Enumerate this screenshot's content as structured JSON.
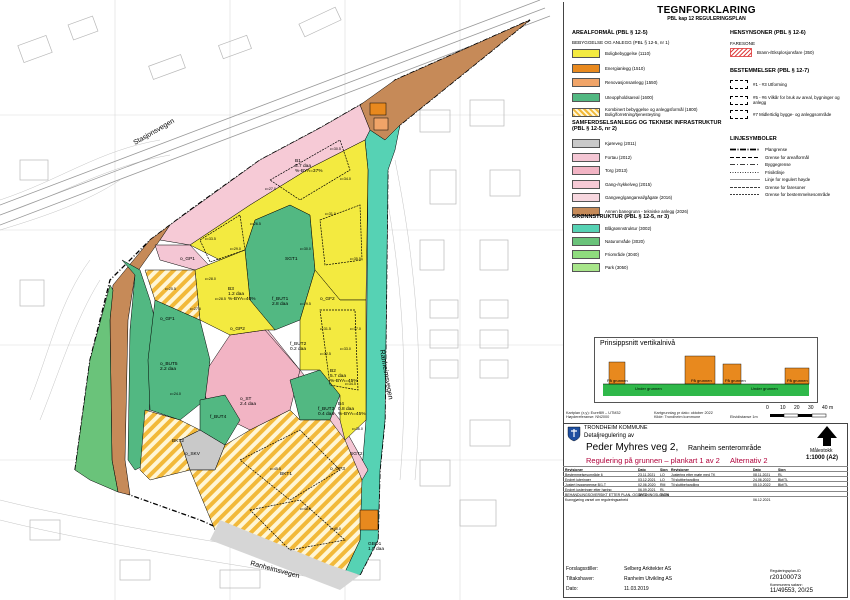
{
  "map": {
    "road_labels": [
      "Stasjonsvegen",
      "Ranheimsvegen",
      "Ranheimsvegen"
    ],
    "zone_labels": [
      {
        "code": "B1",
        "detail": "5.7 daa",
        "extra": "%-BYA=37%"
      },
      {
        "code": "B3",
        "detail": "1.2 daa",
        "extra": "%-BYA=40%"
      },
      {
        "code": "f_BUT1",
        "detail": "2.8 daa",
        "extra": ""
      },
      {
        "code": "f_BUT2",
        "detail": "0.2 daa",
        "extra": ""
      },
      {
        "code": "f_BUT3",
        "detail": "0.4 daa",
        "extra": ""
      },
      {
        "code": "f_BUT4",
        "detail": "",
        "extra": ""
      },
      {
        "code": "o_BUT5",
        "detail": "2.2 daa",
        "extra": ""
      },
      {
        "code": "B2",
        "detail": "5.7 daa",
        "extra": "%-BYA=45%"
      },
      {
        "code": "B4",
        "detail": "0.8 daa",
        "extra": "%-BYA=45%"
      },
      {
        "code": "BKT1",
        "detail": "",
        "extra": ""
      },
      {
        "code": "BKT2",
        "detail": "",
        "extra": ""
      },
      {
        "code": "o_ST",
        "detail": "2.4 daa",
        "extra": ""
      },
      {
        "code": "SGT1",
        "detail": "",
        "extra": ""
      },
      {
        "code": "SGT2",
        "detail": "",
        "extra": ""
      },
      {
        "code": "o_SKV",
        "detail": "",
        "extra": ""
      },
      {
        "code": "GBO1",
        "detail": "1.0 daa",
        "extra": ""
      },
      {
        "code": "o_GF1",
        "detail": "",
        "extra": ""
      },
      {
        "code": "o_GF2",
        "detail": "",
        "extra": ""
      },
      {
        "code": "o_GP1",
        "detail": "",
        "extra": ""
      },
      {
        "code": "o_GP2",
        "detail": "",
        "extra": ""
      },
      {
        "code": "o_GP3",
        "detail": "",
        "extra": ""
      }
    ],
    "heights": [
      "c=27.0",
      "c=30.5",
      "c=31.0",
      "c=29.0",
      "c=33.5",
      "c=30.0",
      "c=26.5",
      "c=34.0",
      "c=35.5",
      "c=31.5",
      "c=28.0",
      "c=25.5",
      "c=24.0",
      "c=28.5",
      "c=37.0",
      "c=33.0",
      "c=32.5",
      "c=34.5",
      "c=36.0",
      "c=27.5",
      "c=29.5",
      "c=48.5",
      "c=45.5",
      "c=40.0"
    ]
  },
  "legend": {
    "title": "TEGNFORKLARING",
    "subtitle": "PBL kap 12 REGULERINGSPLAN",
    "left_sections": [
      {
        "heading": "AREALFORMÅL (PBL § 12-5)",
        "subheading": "BEBYGGELSE OG ANLEGG (PBL § 12-5, nr 1)",
        "items": [
          {
            "label": "Boligbebyggelse (1110)",
            "color": "#f3ea40",
            "pattern": "solid"
          },
          {
            "label": "Energianlegg (1510)",
            "color": "#e8891e",
            "pattern": "solid"
          },
          {
            "label": "Renovasjonsanlegg (1550)",
            "color": "#f0a468",
            "pattern": "solid"
          },
          {
            "label": "Uteoppholdsareal (1600)",
            "color": "#52b882",
            "pattern": "solid"
          },
          {
            "label": "Kombinert bebyggelse og anleggsformål (1800) Bolig/forretning/tjenesteyting",
            "color": "#f2b93a",
            "pattern": "stripes"
          }
        ]
      },
      {
        "heading": "SAMFERDSELSANLEGG OG TEKNISK INFRASTRUKTUR (PBL § 12-5, nr 2)",
        "subheading": "",
        "items": [
          {
            "label": "Kjøreveg (2011)",
            "color": "#c9c9c9",
            "pattern": "solid"
          },
          {
            "label": "Fortau (2012)",
            "color": "#f4c6d4",
            "pattern": "solid"
          },
          {
            "label": "Torg (2013)",
            "color": "#f2b4c4",
            "pattern": "solid"
          },
          {
            "label": "Gang-/sykkelveg (2015)",
            "color": "#f6cad6",
            "pattern": "solid"
          },
          {
            "label": "Gangveg/gangareal/gågate (2016)",
            "color": "#f7d7df",
            "pattern": "solid"
          },
          {
            "label": "Annen banegrunn - tekniske anlegg (2026)",
            "color": "#c68a58",
            "pattern": "solid"
          }
        ]
      },
      {
        "heading": "GRØNNSTRUKTUR (PBL § 12-5, nr 3)",
        "subheading": "",
        "items": [
          {
            "label": "Blågrønnstruktur (3002)",
            "color": "#56d2b4",
            "pattern": "solid"
          },
          {
            "label": "Naturområde (3020)",
            "color": "#6ac37a",
            "pattern": "solid"
          },
          {
            "label": "Friområde (3040)",
            "color": "#8fdc7e",
            "pattern": "solid"
          },
          {
            "label": "Park (3050)",
            "color": "#a8e68a",
            "pattern": "solid"
          }
        ]
      }
    ],
    "hensynsoner": {
      "heading": "HENSYNSONER (PBL § 12-6)",
      "subheading": "FARESONE",
      "items": [
        {
          "label": "Brann-/Eksplosjonsfare (350)"
        }
      ]
    },
    "bestemmelser": {
      "heading": "BESTEMMELSER (PBL § 12-7)",
      "items": [
        {
          "label": "#1 - #3 Utforming"
        },
        {
          "label": "#5 - #6 Vilkår for bruk av areal, bygninger og anlegg"
        },
        {
          "label": "#7 Midlertidig bygge- og anleggsområde"
        }
      ]
    },
    "linjesymboler": {
      "heading": "LINJESYMBOLER",
      "items": [
        {
          "label": "Plangrense",
          "style": "plan"
        },
        {
          "label": "Grense for arealformål",
          "style": "dash"
        },
        {
          "label": "Byggegrense",
          "style": "dashdot"
        },
        {
          "label": "Frisiktlinje",
          "style": "dot"
        },
        {
          "label": "Linje for regulert høyde",
          "style": "thin"
        },
        {
          "label": "Grense for faresoner",
          "style": "fare"
        },
        {
          "label": "Grense for bestemmelsesområde",
          "style": "bestem"
        }
      ]
    }
  },
  "profile": {
    "title": "Prinsippsnitt vertikalnivå",
    "labels": [
      "På grunnen",
      "På grunnen",
      "Under grunnen",
      "På grunnen",
      "Under grunnen",
      "På grunnen"
    ]
  },
  "info_block": {
    "left": [
      "Kartplan (x,y): Euref89 – UTM32",
      "Høydereferanse: NN2000"
    ],
    "right": [
      "Kartgrunnlag pr dato: oktober 2022",
      "Kilde: Trondheim kommune",
      "Ekvidistanse 1m"
    ]
  },
  "scalebar": {
    "ticks": [
      "0",
      "10",
      "20",
      "30",
      "40 m"
    ]
  },
  "title_block": {
    "municipality": "TRONDHEIM KOMMUNE",
    "plan_type": "Detaljregulering av",
    "plan_name": "Peder Myhres veg 2,",
    "plan_place": "Ranheim senterområde",
    "plan_sub": "Regulering på grunnen – plankart 1 av 2",
    "alternative": "Alternativ 2",
    "scale_label": "Målestokk",
    "scale_value": "1:1000 (A2)",
    "revision_headers": [
      "Revisjoner",
      "Dato",
      "Sign",
      "Revisjoner",
      "Dato",
      "Sign"
    ],
    "rows": [
      [
        "Bestemmelsesområde 6",
        "23.11.2021",
        "LO",
        "Justering etter møte med TK",
        "08.11.2021",
        "RL"
      ],
      [
        "Endret juteringer",
        "03.12.2021",
        "LO",
        "Til sluttbehandling",
        "24.06.2022",
        "Bkt/TL"
      ],
      [
        "Justert byggegrense B/1,T",
        "02.06.2020",
        "RM",
        "Til sluttbehandling",
        "05.10.2022",
        "Bkt/TL"
      ],
      [
        "Endret justeringer etter høring",
        "06.09.2021",
        "RL",
        "",
        "",
        ""
      ],
      [
        "BEHANDLINGSOVERSIKT ETTER PLAN- OG BYGNINGSLOVEN",
        "DATO",
        "SIGN",
        "",
        "",
        ""
      ],
      [
        "Kunngjøring varsel om reguleringsarbeid",
        "",
        "",
        "",
        "06.12.2021",
        ""
      ]
    ],
    "footer": [
      {
        "label": "Forslagsstiller:",
        "value": "Selberg Arkitekter AS"
      },
      {
        "label": "Tiltakshaver:",
        "value": "Ranheim Utvikling AS"
      },
      {
        "label": "Dato:",
        "value": "11.03.2019"
      }
    ],
    "plan_id_label": "Reguleringsplan-ID",
    "plan_id": "r20100073",
    "case_label": "Kommunens saksnr:",
    "case_no": "11/49553, 20/25"
  },
  "colors": {
    "residential": "#f3ea40",
    "combined": "#f2b93a",
    "outdoor": "#52b882",
    "blue_green": "#56d2b4",
    "rail": "#c68a58",
    "pink": "#f4c6d4",
    "road": "#c9c9c9"
  }
}
